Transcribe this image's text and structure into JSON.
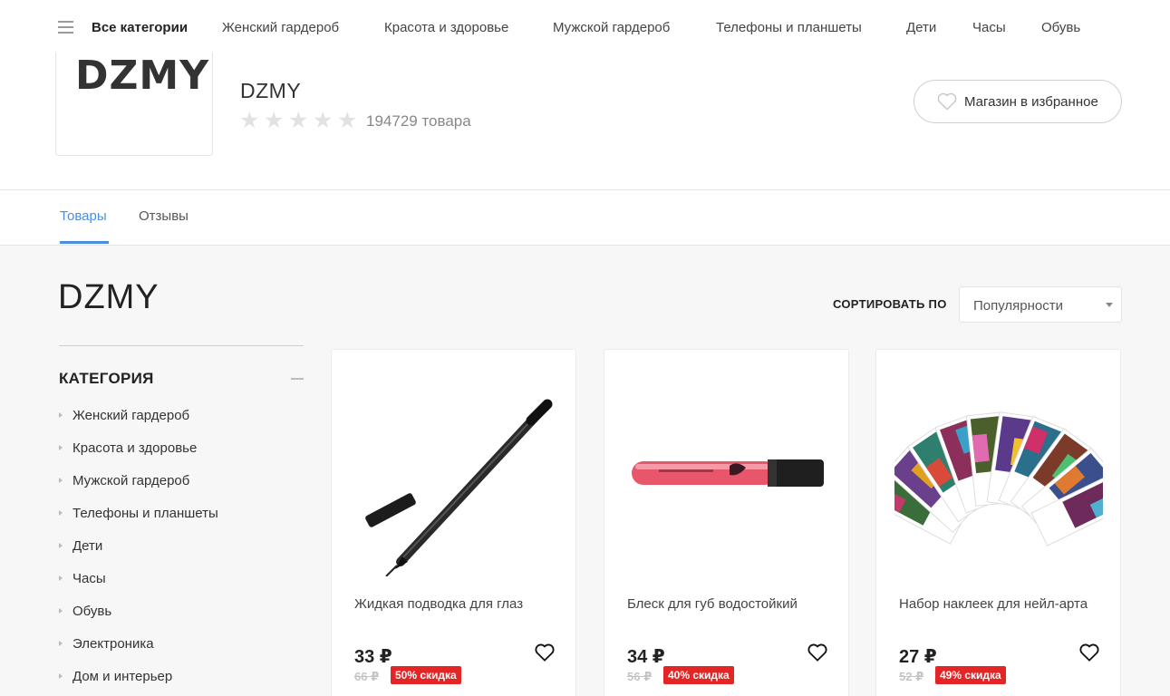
{
  "nav": {
    "items": [
      "Все категории",
      "Женский гардероб",
      "Красота и здоровье",
      "Мужской гардероб",
      "Телефоны и планшеты",
      "Дети",
      "Часы",
      "Обувь"
    ]
  },
  "store": {
    "logo_text": "DZMY",
    "name": "DZMY",
    "rating_stars": 0,
    "goods_count": "194729 товара",
    "favorite_label": "Магазин в избранное"
  },
  "tabs": [
    {
      "label": "Товары",
      "active": true
    },
    {
      "label": "Отзывы",
      "active": false
    }
  ],
  "page": {
    "title": "DZMY",
    "sort_label": "СОРТИРОВАТЬ ПО",
    "sort_value": "Популярности"
  },
  "sidebar": {
    "category_title": "КАТЕГОРИЯ",
    "items": [
      "Женский гардероб",
      "Красота и здоровье",
      "Мужской гардероб",
      "Телефоны и планшеты",
      "Дети",
      "Часы",
      "Обувь",
      "Электроника",
      "Дом и интерьер"
    ]
  },
  "products": [
    {
      "title": "Жидкая подводка для глаз",
      "price": "33 ₽",
      "old_price": "66 ₽",
      "discount": "50% скидка",
      "icon": "eyeliner-image"
    },
    {
      "title": "Блеск для губ водостойкий",
      "price": "34 ₽",
      "old_price": "56 ₽",
      "discount": "40% скидка",
      "icon": "lip-gloss-image"
    },
    {
      "title": "Набор наклеек для нейл-арта",
      "price": "27 ₽",
      "old_price": "52 ₽",
      "discount": "49% скидка",
      "icon": "nail-stickers-image"
    }
  ],
  "colors": {
    "accent": "#4a8fdc",
    "badge": "#e32525"
  }
}
